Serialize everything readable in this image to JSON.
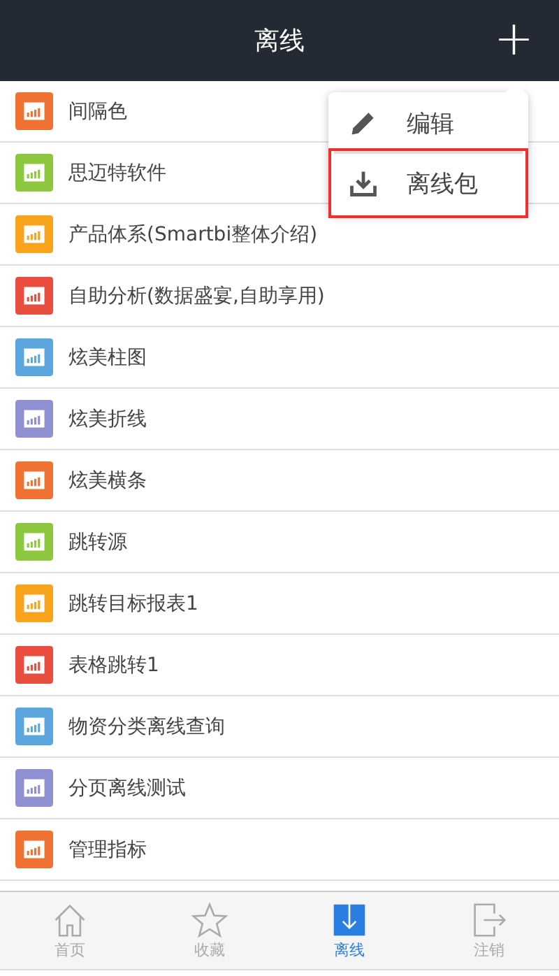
{
  "header": {
    "title": "离线",
    "add_button": "+"
  },
  "menu": [
    {
      "kind": "edit",
      "label": "编辑",
      "highlighted": false
    },
    {
      "kind": "download",
      "label": "离线包",
      "highlighted": true
    }
  ],
  "items": [
    {
      "label": "间隔色",
      "color": "#f07232"
    },
    {
      "label": "思迈特软件",
      "color": "#8dc63f"
    },
    {
      "label": "产品体系(Smartbi整体介绍)",
      "color": "#f9a21b"
    },
    {
      "label": "自助分析(数据盛宴,自助享用)",
      "color": "#e84d3d"
    },
    {
      "label": "炫美柱图",
      "color": "#5ba6dd"
    },
    {
      "label": "炫美折线",
      "color": "#8e90d2"
    },
    {
      "label": "炫美横条",
      "color": "#f07232"
    },
    {
      "label": "跳转源",
      "color": "#8dc63f"
    },
    {
      "label": "跳转目标报表1",
      "color": "#f9a21b"
    },
    {
      "label": "表格跳转1",
      "color": "#e84d3d"
    },
    {
      "label": "物资分类离线查询",
      "color": "#5ba6dd"
    },
    {
      "label": "分页离线测试",
      "color": "#8e90d2"
    },
    {
      "label": "管理指标",
      "color": "#f07232"
    }
  ],
  "tabs": [
    {
      "kind": "home",
      "label": "首页",
      "selected": false
    },
    {
      "kind": "star",
      "label": "收藏",
      "selected": false
    },
    {
      "kind": "offline",
      "label": "离线",
      "selected": true
    },
    {
      "kind": "logout",
      "label": "注销",
      "selected": false
    }
  ]
}
